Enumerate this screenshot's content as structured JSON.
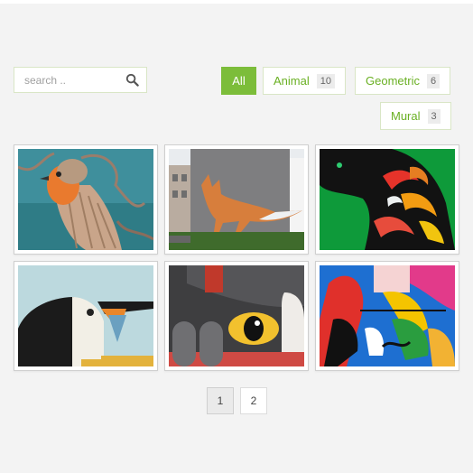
{
  "search": {
    "placeholder": "search ..",
    "value": "",
    "icon": "search-icon"
  },
  "filters": [
    {
      "label": "All",
      "count": null,
      "active": true
    },
    {
      "label": "Animal",
      "count": "10",
      "active": false
    },
    {
      "label": "Geometric",
      "count": "6",
      "active": false
    },
    {
      "label": "Mural",
      "count": "3",
      "active": false
    }
  ],
  "gallery": {
    "items": [
      {
        "subject": "robin-bird-artwork"
      },
      {
        "subject": "fox-street-mural"
      },
      {
        "subject": "black-panther-artwork"
      },
      {
        "subject": "toucan-geometric-artwork"
      },
      {
        "subject": "geometric-eye-artwork"
      },
      {
        "subject": "colorful-abstract-figure-artwork"
      }
    ]
  },
  "pagination": {
    "pages": [
      "1",
      "2"
    ],
    "current": "1"
  },
  "colors": {
    "accent": "#7cbd3a",
    "accent_text": "#6ab023",
    "background": "#f3f3f3"
  }
}
